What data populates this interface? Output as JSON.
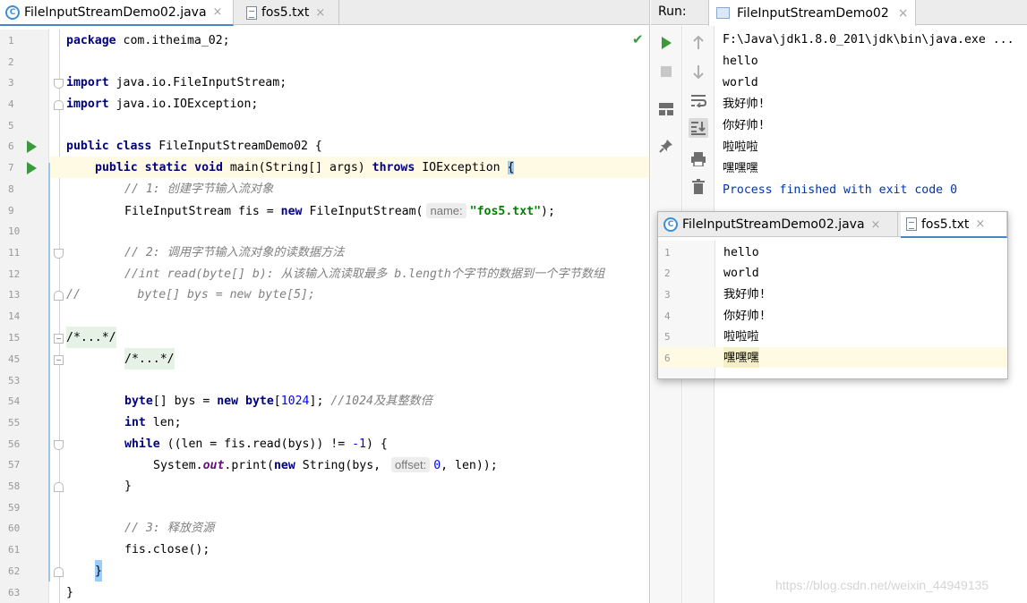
{
  "editor": {
    "tabs": [
      {
        "label": "FileInputStreamDemo02.java",
        "close": "×",
        "icon": "java-class-icon",
        "active": true
      },
      {
        "label": "fos5.txt",
        "close": "×",
        "icon": "text-file-icon",
        "active": false
      }
    ],
    "line_numbers": [
      "1",
      "2",
      "3",
      "4",
      "5",
      "6",
      "7",
      "8",
      "9",
      "10",
      "11",
      "12",
      "13",
      "14",
      "15",
      "45",
      "53",
      "54",
      "55",
      "56",
      "57",
      "58",
      "59",
      "60",
      "61",
      "62",
      "63"
    ],
    "code": {
      "l1_kw": "package",
      "l1_rest": " com.itheima_02;",
      "l3_kw": "import",
      "l3_rest": " java.io.FileInputStream;",
      "l4_kw": "import",
      "l4_rest": " java.io.IOException;",
      "l6_kw": "public class",
      "l6_rest": " FileInputStreamDemo02 {",
      "l7_kw1": "public static void",
      "l7_mid": " main(String[] args) ",
      "l7_kw2": "throws",
      "l7_rest": " IOException ",
      "l7_brace": "{",
      "l8_cm": "// 1: 创建字节输入流对象",
      "l9_a": "FileInputStream fis = ",
      "l9_kw": "new",
      "l9_b": " FileInputStream(",
      "l9_hint": "name:",
      "l9_str": "\"fos5.txt\"",
      "l9_c": ");",
      "l11_cm": "// 2: 调用字节输入流对象的读数据方法",
      "l12_cm": "//int read(byte[] b): 从该输入流读取最多 b.length个字节的数据到一个字节数组",
      "l13_cm": "//        byte[] bys = new byte[5];",
      "l15_fold": "/*...*/",
      "l45_fold": "/*...*/",
      "l54_kw1": "byte",
      "l54_a": "[] bys = ",
      "l54_kw2": "new",
      "l54_b": " ",
      "l54_kw3": "byte",
      "l54_c": "[",
      "l54_num": "1024",
      "l54_d": "]; ",
      "l54_cm": "//1024及其整数倍",
      "l55_kw": "int",
      "l55_rest": " len;",
      "l56_kw": "while",
      "l56_a": " ((len = fis.read(bys)) != ",
      "l56_num": "-1",
      "l56_b": ") {",
      "l57_a": "System.",
      "l57_fld": "out",
      "l57_b": ".print(",
      "l57_kw": "new",
      "l57_c": " String(bys, ",
      "l57_hint": "offset:",
      "l57_num": "0",
      "l57_d": ", len));",
      "l58": "}",
      "l60_cm": "// 3: 释放资源",
      "l61": "fis.close();",
      "l62": "}",
      "l63": "}"
    }
  },
  "run": {
    "label": "Run:",
    "tab_label": "FileInputStreamDemo02",
    "tab_close": "×",
    "console": [
      "F:\\Java\\jdk1.8.0_201\\jdk\\bin\\java.exe ...",
      "hello",
      "world",
      "我好帅!",
      "你好帅!",
      "啦啦啦",
      "嘿嘿嘿",
      "Process finished with exit code 0"
    ]
  },
  "popup": {
    "tabs": [
      {
        "label": "FileInputStreamDemo02.java",
        "close": "×"
      },
      {
        "label": "fos5.txt",
        "close": "×"
      }
    ],
    "line_numbers": [
      "1",
      "2",
      "3",
      "4",
      "5",
      "6"
    ],
    "lines": [
      "hello",
      "world",
      "我好帅!",
      "你好帅!",
      "啦啦啦",
      "嘿嘿嘿"
    ]
  },
  "watermark": "https://blog.csdn.net/weixin_44949135"
}
